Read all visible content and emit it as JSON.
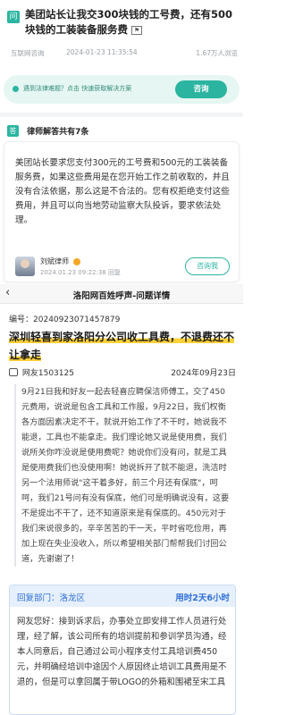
{
  "question": {
    "icon": "问",
    "title": "美团站长让我交300块钱的工号费，还有500块钱的工装装备服务费",
    "flag_icon": "flag-icon",
    "source": "互联网咨询",
    "time": "2024-01-23 11:35:54",
    "views": "1.67万人浏览"
  },
  "banner": {
    "text": "遇到法律难题？点击 快速获取解决方案",
    "button": "咨询"
  },
  "answers": {
    "icon": "答",
    "heading": "律师解答共有7条"
  },
  "answer": {
    "text": "美团站长要求您支付300元的工号费和500元的工装装备服务费，如果这些费用是在您开始工作之前收取的，并且没有合法依据，那么这是不合法的。您有权拒绝支付这些费用，并且可以向当地劳动监察大队投诉，要求依法处理。",
    "lawyer_name": "刘斌律师",
    "time": "2024.01.23 09:22:38 回复",
    "consult_button": "咨询我"
  },
  "luoyang": {
    "back": "‹",
    "nav_title": "洛阳网百姓呼声-问题详情",
    "number_label": "编号：",
    "number": "20240923071457879",
    "title": "深圳轻喜到家洛阳分公司收工具费，不退费还不让拿走",
    "author": "网友1503125",
    "date": "2024年09月23日",
    "body": "9月21日我和好友一起去轻喜应聘保洁师傅工，交了450元费用，说说是包含工具和工作服，9月22日，我们权衡各方面因素决定不干，就说开始工作了不干时，她说我不能退，工具也不能拿走。我们理论她又说是使用费，我们说所关你咋没说是使用费呢？她说你们没有问，就是工具是使用费我们也没使用啊！她说拆开了就不能退，洗洁时另一个法用师说\"这干着多好，前三个月还有保底\"，呵呵，我们21号问有没有保底，他们可是明确说没有，这要不是提出不干了，还不知道原来是有保底的。450元对于我们来说很多的，辛辛苦苦的干一天，平时省吃俭用，再加上现在失业没收入，所以希望相关部门帮帮我们讨回公道，先谢谢了！",
    "reply": {
      "dept": "回复部门：洛龙区",
      "duration": "用时2天6小时",
      "text": "网友您好：接到诉求后，办事处立即安排工作人员进行处理，经了解，该公司所有的培训提前和参训学员沟通，经本人同意后，自己通过公司小程序支付工具培训费450元，并明确经培训中途因个人原因终止培训工具费用是不退的，但是可以拿回属于带LOGO的外箱和围裙至宋工具"
    }
  }
}
